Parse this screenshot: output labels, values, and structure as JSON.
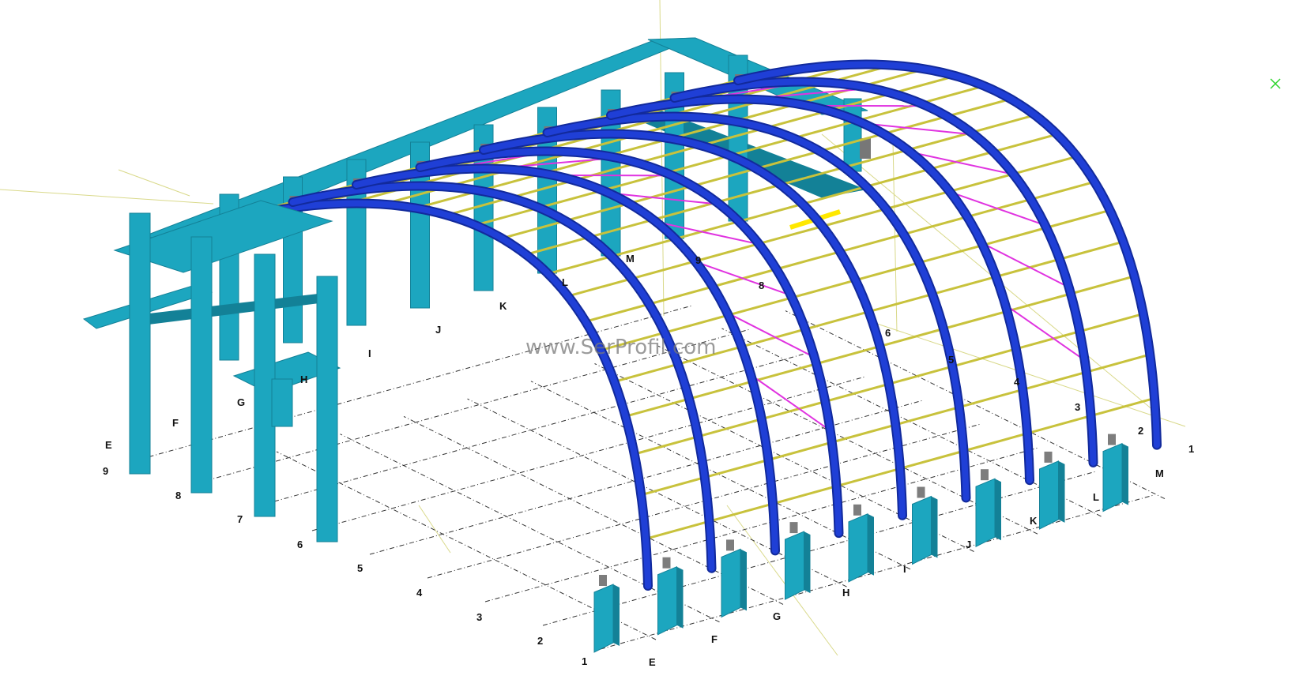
{
  "watermark": "www.SerProfil.com",
  "grid": {
    "front_numbers": [
      "1",
      "2",
      "3",
      "4",
      "5",
      "6",
      "7",
      "8",
      "9"
    ],
    "front_letters": [
      "E",
      "F",
      "G",
      "H",
      "I",
      "J",
      "K",
      "L",
      "M"
    ],
    "back_letters": [
      "E",
      "F",
      "G",
      "H",
      "I",
      "J",
      "K",
      "L",
      "M"
    ],
    "back_numbers": [
      "1",
      "2",
      "3",
      "4",
      "5",
      "6",
      "8",
      "9"
    ]
  },
  "colors": {
    "concrete": "#1ca6bf",
    "concrete_dark": "#138197",
    "arch_steel": "#1f3fd6",
    "arch_dark": "#122a9c",
    "purlin": "#c8c23c",
    "bracing": "#e033e0",
    "highlight": "#ffe800",
    "grid_line": "#333333",
    "guide_line": "#d9d98a",
    "cursor": "#2bd42b"
  },
  "icons": {
    "cursor": "cross-cursor-icon"
  }
}
